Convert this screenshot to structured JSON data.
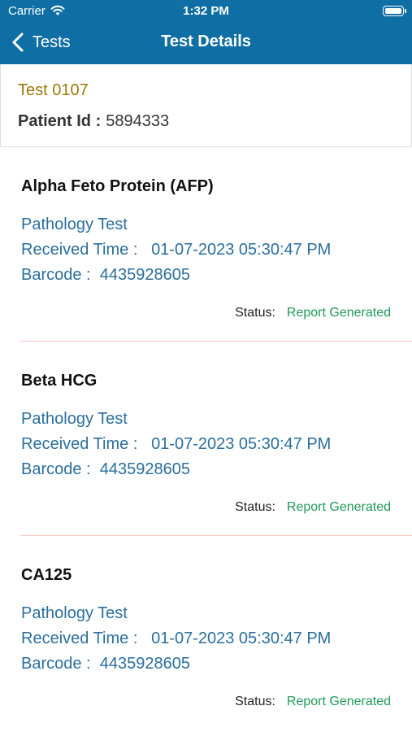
{
  "status_bar": {
    "carrier": "Carrier",
    "time": "1:32 PM"
  },
  "nav": {
    "back_label": "Tests",
    "title": "Test Details"
  },
  "header": {
    "test_id": "Test 0107",
    "patient_label": "Patient Id :",
    "patient_id": "5894333"
  },
  "tests": [
    {
      "name": "Alpha Feto Protein (AFP)",
      "type": "Pathology Test",
      "received_label": "Received Time :",
      "received_time": "01-07-2023 05:30:47 PM",
      "barcode_label": "Barcode :",
      "barcode": "4435928605",
      "status_label": "Status:",
      "status": "Report Generated"
    },
    {
      "name": "Beta HCG",
      "type": "Pathology Test",
      "received_label": "Received Time :",
      "received_time": "01-07-2023 05:30:47 PM",
      "barcode_label": "Barcode :",
      "barcode": "4435928605",
      "status_label": "Status:",
      "status": "Report Generated"
    },
    {
      "name": "CA125",
      "type": "Pathology Test",
      "received_label": "Received Time :",
      "received_time": "01-07-2023 05:30:47 PM",
      "barcode_label": "Barcode :",
      "barcode": "4435928605",
      "status_label": "Status:",
      "status": "Report Generated"
    }
  ],
  "colors": {
    "nav_bar": "#0f6fa5",
    "test_id": "#9a7a08",
    "info_text": "#2a6f9e",
    "status_ok": "#1e9a57",
    "separator": "#f3c9bd"
  },
  "icons": {
    "back": "chevron-left-icon",
    "wifi": "wifi-icon",
    "battery": "battery-icon"
  }
}
